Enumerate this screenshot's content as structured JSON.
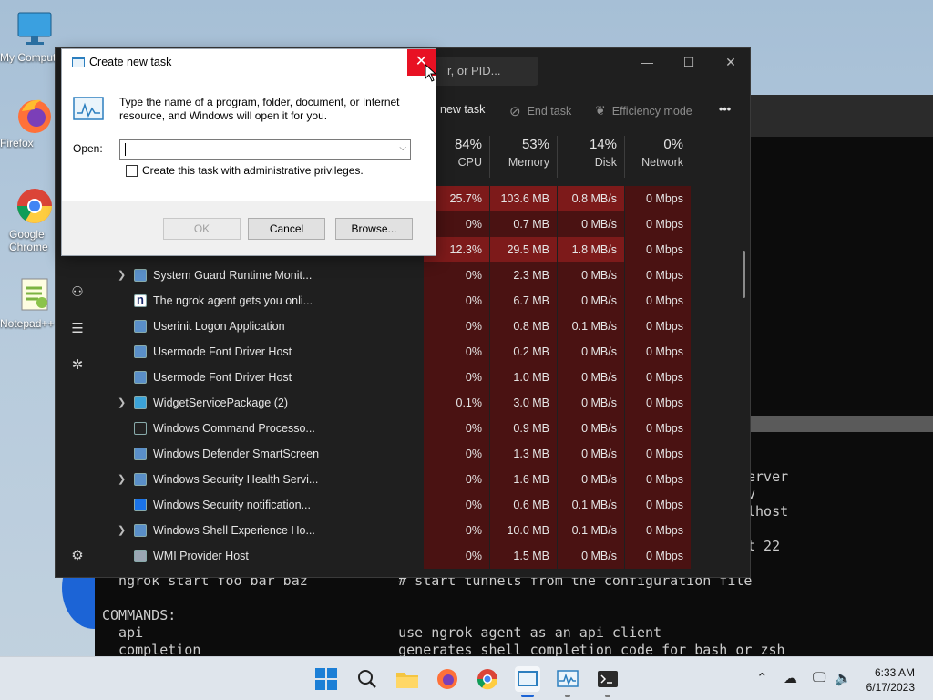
{
  "desktop": {
    "icons": [
      {
        "label": "My Computer"
      },
      {
        "label": "Firefox"
      },
      {
        "label": "Google Chrome"
      },
      {
        "label": "Notepad++"
      }
    ]
  },
  "terminal": {
    "lines": [
      {
        "text": "erver"
      },
      {
        "text": "v"
      },
      {
        "text": "lhost"
      },
      {
        "text": "t 22"
      },
      {
        "text": "  ngrok start foo bar baz           # start tunnels from the configuration file"
      },
      {
        "text": "COMMANDS:"
      },
      {
        "text": "  api                               use ngrok agent as an api client"
      },
      {
        "text": "  completion                        generates shell completion code for bash or zsh"
      }
    ]
  },
  "taskmanager": {
    "search_placeholder": "r, or PID...",
    "toolbar": {
      "new_task": "new task",
      "end_task": "End task",
      "efficiency_mode": "Efficiency mode",
      "more": "•••"
    },
    "columns": [
      {
        "pct": "84%",
        "name": "CPU"
      },
      {
        "pct": "53%",
        "name": "Memory"
      },
      {
        "pct": "14%",
        "name": "Disk"
      },
      {
        "pct": "0%",
        "name": "Network"
      }
    ],
    "processes": [
      {
        "name": "",
        "cpu": "25.7%",
        "memory": "103.6 MB",
        "disk": "0.8 MB/s",
        "network": "0 Mbps",
        "expand": false,
        "icon": "none"
      },
      {
        "name": "",
        "cpu": "0%",
        "memory": "0.7 MB",
        "disk": "0 MB/s",
        "network": "0 Mbps",
        "expand": false,
        "icon": "none"
      },
      {
        "name": "",
        "cpu": "12.3%",
        "memory": "29.5 MB",
        "disk": "1.8 MB/s",
        "network": "0 Mbps",
        "expand": false,
        "icon": "none"
      },
      {
        "name": "System Guard Runtime Monit...",
        "cpu": "0%",
        "memory": "2.3 MB",
        "disk": "0 MB/s",
        "network": "0 Mbps",
        "expand": true,
        "icon": "app"
      },
      {
        "name": "The ngrok agent gets you onli...",
        "cpu": "0%",
        "memory": "6.7 MB",
        "disk": "0 MB/s",
        "network": "0 Mbps",
        "expand": false,
        "icon": "ngrok"
      },
      {
        "name": "Userinit Logon Application",
        "cpu": "0%",
        "memory": "0.8 MB",
        "disk": "0.1 MB/s",
        "network": "0 Mbps",
        "expand": false,
        "icon": "app"
      },
      {
        "name": "Usermode Font Driver Host",
        "cpu": "0%",
        "memory": "0.2 MB",
        "disk": "0 MB/s",
        "network": "0 Mbps",
        "expand": false,
        "icon": "app"
      },
      {
        "name": "Usermode Font Driver Host",
        "cpu": "0%",
        "memory": "1.0 MB",
        "disk": "0 MB/s",
        "network": "0 Mbps",
        "expand": false,
        "icon": "app"
      },
      {
        "name": "WidgetServicePackage (2)",
        "cpu": "0.1%",
        "memory": "3.0 MB",
        "disk": "0 MB/s",
        "network": "0 Mbps",
        "expand": true,
        "icon": "widget"
      },
      {
        "name": "Windows Command Processo...",
        "cpu": "0%",
        "memory": "0.9 MB",
        "disk": "0 MB/s",
        "network": "0 Mbps",
        "expand": false,
        "icon": "cmd"
      },
      {
        "name": "Windows Defender SmartScreen",
        "cpu": "0%",
        "memory": "1.3 MB",
        "disk": "0 MB/s",
        "network": "0 Mbps",
        "expand": false,
        "icon": "app"
      },
      {
        "name": "Windows Security Health Servi...",
        "cpu": "0%",
        "memory": "1.6 MB",
        "disk": "0 MB/s",
        "network": "0 Mbps",
        "expand": true,
        "icon": "app"
      },
      {
        "name": "Windows Security notification...",
        "cpu": "0%",
        "memory": "0.6 MB",
        "disk": "0.1 MB/s",
        "network": "0 Mbps",
        "expand": false,
        "icon": "shield"
      },
      {
        "name": "Windows Shell Experience Ho...",
        "cpu": "0%",
        "memory": "10.0 MB",
        "disk": "0.1 MB/s",
        "network": "0 Mbps",
        "expand": true,
        "icon": "app"
      },
      {
        "name": "WMI Provider Host",
        "cpu": "0%",
        "memory": "1.5 MB",
        "disk": "0 MB/s",
        "network": "0 Mbps",
        "expand": false,
        "icon": "wmi"
      }
    ]
  },
  "dialog": {
    "title": "Create new task",
    "description": "Type the name of a program, folder, document, or Internet resource, and Windows will open it for you.",
    "open_label": "Open:",
    "open_value": "",
    "admin_label": "Create this task with administrative privileges.",
    "ok": "OK",
    "cancel": "Cancel",
    "browse": "Browse...",
    "close_glyph": "✕"
  },
  "taskbar": {
    "time": "6:33 AM",
    "date": "6/17/2023"
  },
  "colors": {
    "heat_high": "#7d1a1a",
    "heat_low": "#4a1212",
    "accent": "#e81123"
  }
}
